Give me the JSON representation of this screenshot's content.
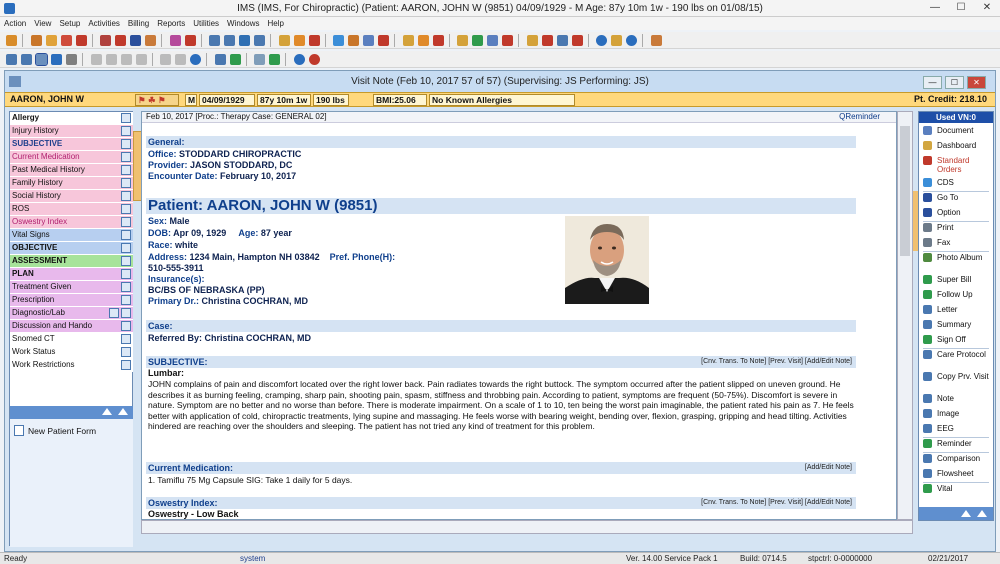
{
  "window": {
    "title": "IMS (IMS, For Chiropractic)    (Patient: AARON, JOHN W (9851) 04/09/1929 - M Age: 87y 10m 1w - 190 lbs on 01/08/15)",
    "min": "—",
    "max": "☐",
    "close": "✕"
  },
  "menu": [
    "Action",
    "View",
    "Setup",
    "Activities",
    "Billing",
    "Reports",
    "Utilities",
    "Windows",
    "Help"
  ],
  "visit": {
    "title": "Visit Note (Feb 10, 2017   57 of 57) (Supervising: JS Performing: JS)",
    "min": "—",
    "max": "☐",
    "close": "✕"
  },
  "patient_bar": {
    "name": "AARON, JOHN W",
    "sex": "M",
    "dob": "04/09/1929",
    "age": "87y 10m 1w",
    "weight": "190 lbs",
    "bmi": "BMI:25.06",
    "allergy": "No Known Allergies",
    "credit": "Pt. Credit: 218.10"
  },
  "left_menu": [
    {
      "label": "Allergy",
      "color": "#ffffff",
      "bold": true
    },
    {
      "label": "Injury History",
      "color": "#f7c6da",
      "bold": false
    },
    {
      "label": "SUBJECTIVE",
      "color": "#f7c6da",
      "bold": true
    },
    {
      "label": "Current Medication",
      "color": "#f7c6da",
      "bold": false
    },
    {
      "label": "Past Medical History",
      "color": "#f7c6da",
      "bold": false
    },
    {
      "label": "Family History",
      "color": "#f7c6da",
      "bold": false
    },
    {
      "label": "Social History",
      "color": "#f7c6da",
      "bold": false
    },
    {
      "label": "ROS",
      "color": "#f7c6da",
      "bold": false
    },
    {
      "label": "Oswestry Index",
      "color": "#f7c6da",
      "bold": false
    },
    {
      "label": "Vital Signs",
      "color": "#b7cff0",
      "bold": false
    },
    {
      "label": "OBJECTIVE",
      "color": "#b7cff0",
      "bold": true
    },
    {
      "label": "ASSESSMENT",
      "color": "#a7e39a",
      "bold": true
    },
    {
      "label": "PLAN",
      "color": "#e8b9ec",
      "bold": true
    },
    {
      "label": "Treatment Given",
      "color": "#e8b9ec",
      "bold": false
    },
    {
      "label": "Prescription",
      "color": "#e8b9ec",
      "bold": false
    },
    {
      "label": "Diagnostic/Lab",
      "color": "#e8b9ec",
      "bold": false
    },
    {
      "label": "Discussion and Hando",
      "color": "#e8b9ec",
      "bold": false
    },
    {
      "label": "Snomed CT",
      "color": "#ffffff",
      "bold": false
    },
    {
      "label": "Work Status",
      "color": "#ffffff",
      "bold": false
    },
    {
      "label": "Work Restrictions",
      "color": "#ffffff",
      "bold": false
    }
  ],
  "new_patient_form": "New Patient Form",
  "content_header": {
    "left": "Feb 10, 2017  [Proc.: Therapy   Case: GENERAL 02]",
    "right": "QReminder"
  },
  "general": {
    "header": "General:",
    "office_label": "Office:",
    "office": "STODDARD CHIROPRACTIC",
    "provider_label": "Provider:",
    "provider": "JASON STODDARD, DC",
    "date_label": "Encounter Date:",
    "date": "February 10, 2017"
  },
  "patient": {
    "header": "Patient: AARON, JOHN W  (9851)",
    "sex_label": "Sex:",
    "sex": "Male",
    "dob_label": "DOB:",
    "dob": "Apr 09, 1929",
    "age_label": "Age:",
    "age": "87 year",
    "race_label": "Race:",
    "race": "white",
    "address_label": "Address:",
    "address": "1234 Main,  Hampton  NH  03842",
    "phone_label": "Pref. Phone(H):",
    "phone": "510-555-3911",
    "insurance_label": "Insurance(s):",
    "insurance": "BC/BS OF NEBRASKA (PP)",
    "primary_label": "Primary Dr.:",
    "primary": "Christina COCHRAN, MD"
  },
  "case": {
    "header": "Case:",
    "referred_label": "Referred By:",
    "referred": "Christina COCHRAN, MD"
  },
  "subjective": {
    "header": "SUBJECTIVE:",
    "links": "[Cnv. Trans. To Note]  [Prev. Visit]  [Add/Edit Note]",
    "sub": "Lumbar:",
    "text": "JOHN complains of pain and discomfort located over the right lower back. Pain radiates towards the right buttock. The symptom occurred after the patient slipped on uneven ground. He describes it as burning feeling, cramping, sharp pain, shooting pain, spasm, stiffness and throbbing pain. According to patient, symptoms are frequent (50-75%). Discomfort is severe in nature. Symptom are no better and no worse than before. There is moderate impairment. On a scale of 1 to 10, ten being the worst pain imaginable, the patient rated his pain as 7. He feels better with application of cold, chiropractic treatments, lying supine and massaging. He feels worse with bearing weight, bending over, flexion, grasping, gripping and head tilting. Activities hindered are reaching over the shoulders and sleeping. The patient has not tried any kind of treatment for this problem."
  },
  "medication": {
    "header": "Current Medication:",
    "links": "[Add/Edit Note]",
    "text": "1. Tamiflu 75 Mg Capsule  SIG: Take 1 daily for 5 days."
  },
  "oswestry": {
    "header": "Oswestry Index:",
    "links": "[Cnv. Trans. To Note]  [Prev. Visit]  [Add/Edit Note]",
    "sub": "Oswestry - Low Back"
  },
  "right_panel": {
    "top": "Used VN:0",
    "items": [
      {
        "label": "Document",
        "color": "#5a7fbf"
      },
      {
        "label": "Dashboard",
        "color": "#d2a640"
      },
      {
        "label": "Standard Orders",
        "color": "#c0392b",
        "red": true
      },
      {
        "label": "CDS",
        "color": "#3b8ed8"
      },
      {
        "label": "Go To",
        "color": "#2a4f9c"
      },
      {
        "label": "Option",
        "color": "#2a4f9c"
      },
      {
        "label": "Print",
        "color": "#6c7a89"
      },
      {
        "label": "Fax",
        "color": "#6c7a89"
      },
      {
        "label": "Photo Album",
        "color": "#4f8a3f"
      },
      {
        "label": "Super Bill",
        "color": "#2f9b4c"
      },
      {
        "label": "Follow Up",
        "color": "#2f9b4c"
      },
      {
        "label": "Letter",
        "color": "#4a78b0"
      },
      {
        "label": "Summary",
        "color": "#4a78b0"
      },
      {
        "label": "Sign Off",
        "color": "#2f9b4c"
      },
      {
        "label": "Care Protocol",
        "color": "#4a78b0"
      },
      {
        "label": "Copy Prv. Visit",
        "color": "#4a78b0"
      },
      {
        "label": "Note",
        "color": "#4a78b0"
      },
      {
        "label": "Image",
        "color": "#4a78b0"
      },
      {
        "label": "EEG",
        "color": "#4a78b0"
      },
      {
        "label": "Reminder",
        "color": "#2f9b4c"
      },
      {
        "label": "Comparison",
        "color": "#4a78b0"
      },
      {
        "label": "Flowsheet",
        "color": "#4a78b0"
      },
      {
        "label": "Vital",
        "color": "#2f9b4c"
      }
    ]
  },
  "statusbar": {
    "ready": "Ready",
    "user": "system",
    "version": "Ver. 14.00 Service Pack 1",
    "build": "Build: 0714.5",
    "stpctrl": "stpctrl: 0-0000000",
    "date": "02/21/2017"
  }
}
